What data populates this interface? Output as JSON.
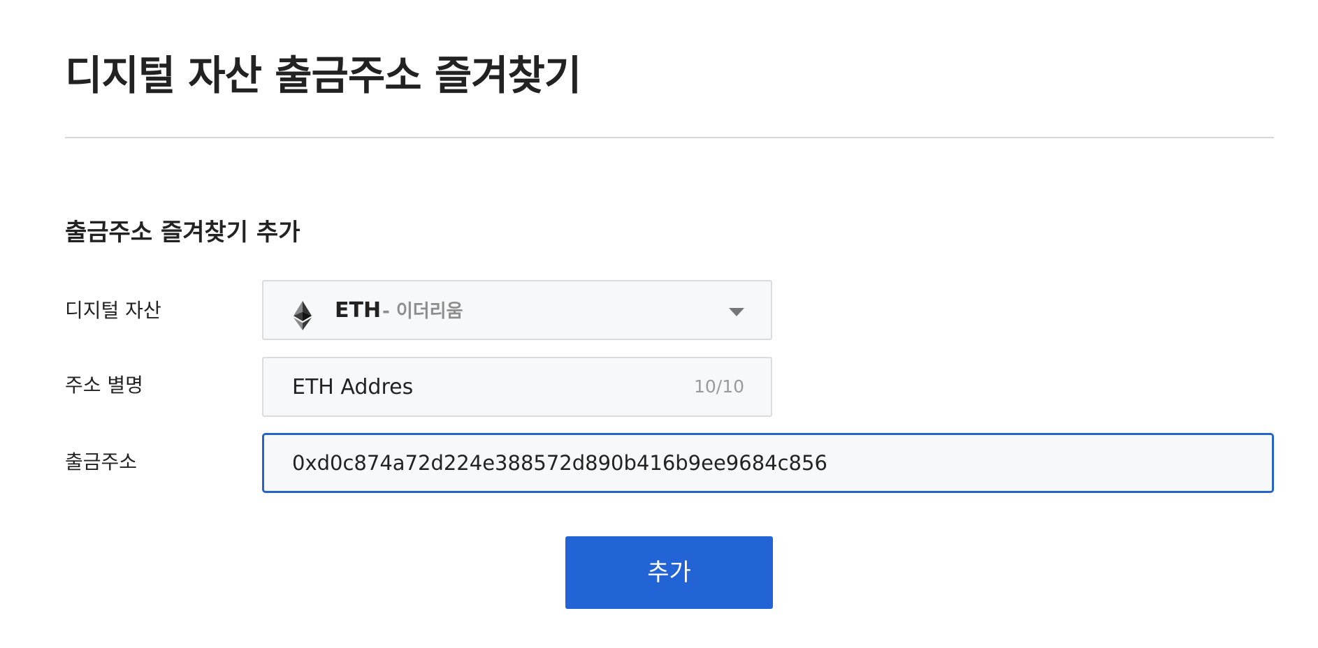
{
  "page": {
    "title": "디지털 자산 출금주소 즐겨찾기"
  },
  "form": {
    "section_title": "출금주소 즐겨찾기 추가",
    "asset_field": {
      "label": "디지털 자산",
      "selected_symbol": "ETH",
      "selected_name": "- 이더리움",
      "icon": "ethereum-icon"
    },
    "nickname_field": {
      "label": "주소 별명",
      "value": "ETH Addres",
      "counter": "10/10"
    },
    "address_field": {
      "label": "출금주소",
      "value": "0xd0c874a72d224e388572d890b416b9ee9684c856"
    },
    "submit_label": "추가"
  },
  "colors": {
    "accent": "#2264d6",
    "focus_border": "#2565c7",
    "input_background": "#f7f8fa",
    "text": "#222222",
    "muted_text": "#8d8d8d"
  }
}
